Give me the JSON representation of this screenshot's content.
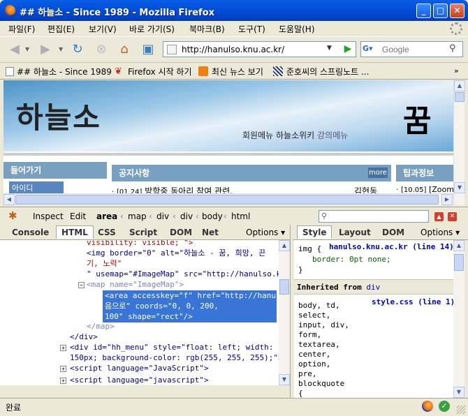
{
  "window": {
    "title": "## 하늘소 - Since 1989 - Mozilla Firefox"
  },
  "menubar": [
    "파일(F)",
    "편집(E)",
    "보기(V)",
    "바로 가기(S)",
    "북마크(B)",
    "도구(T)",
    "도움말(H)"
  ],
  "urlbar": {
    "url": "http://hanulso.knu.ac.kr/"
  },
  "search": {
    "placeholder": "Google"
  },
  "bookmarks": [
    "## 하늘소 - Since 1989",
    "Firefox 시작 하기",
    "최신 뉴스 보기",
    "준호씨의 스프링노트 ..."
  ],
  "page": {
    "logo": "하늘소",
    "kkum": "꿈",
    "topnav": {
      "member": "회원메뉴",
      "wiki": "하늘소위키",
      "lecture": "강의메뉴"
    },
    "login_title": "들어가기",
    "login_id": "아이디",
    "notice_title": "공지사항",
    "notice_more": "more",
    "notice_item": {
      "date": "[01.24]",
      "title": "방학중 동아리 참여 관련.",
      "author": "김현동"
    },
    "tips_title": "팁과정보",
    "tips_item": {
      "date": "[10.05]",
      "title": "[Zoom"
    }
  },
  "firebug": {
    "inspect": "Inspect",
    "edit": "Edit",
    "breadcrumbs": [
      "area",
      "map",
      "div",
      "div",
      "body",
      "html"
    ],
    "tabs": [
      "Console",
      "HTML",
      "CSS",
      "Script",
      "DOM",
      "Net"
    ],
    "options": "Options",
    "right_tabs": [
      "Style",
      "Layout",
      "DOM"
    ],
    "html_lines": [
      "visibility: visible; \">",
      "<img border=\"0\" alt=\"하늘소 - 꿈, 희망, 끈",
      "기, 노력\"",
      "\" usemap=\"#ImageMap\" src=\"http://hanulso.knu.a",
      "<map name=\"ImageMap\">",
      "<area accesskey=\"f\" href=\"http://hanulso.",
      "음으로\" coords=\"0, 0, 200,",
      "100\" shape=\"rect\"/>",
      "</map>",
      "</div>",
      "<div id=\"hh_menu\" style=\"float: left; width:",
      "150px; background-color: rgb(255, 255, 255);\">",
      "<script language=\"JavaScript\">",
      "<script language=\"javascript\">"
    ],
    "style": {
      "rule1_selector": "img {",
      "rule1_source": "hanulso.knu.ac.kr (line 14)",
      "rule1_prop": "border: 0pt none;",
      "rule1_close": "}",
      "inherited_label": "Inherited from",
      "inherited_from": "div",
      "rule2_source": "style.css (line 1)",
      "rule2_selectors": [
        "body, td,",
        "select,",
        "input, div,",
        "form,",
        "textarea,",
        "center,",
        "option,",
        "pre,",
        "blockquote",
        "{"
      ]
    }
  },
  "status": {
    "text": "완료"
  }
}
